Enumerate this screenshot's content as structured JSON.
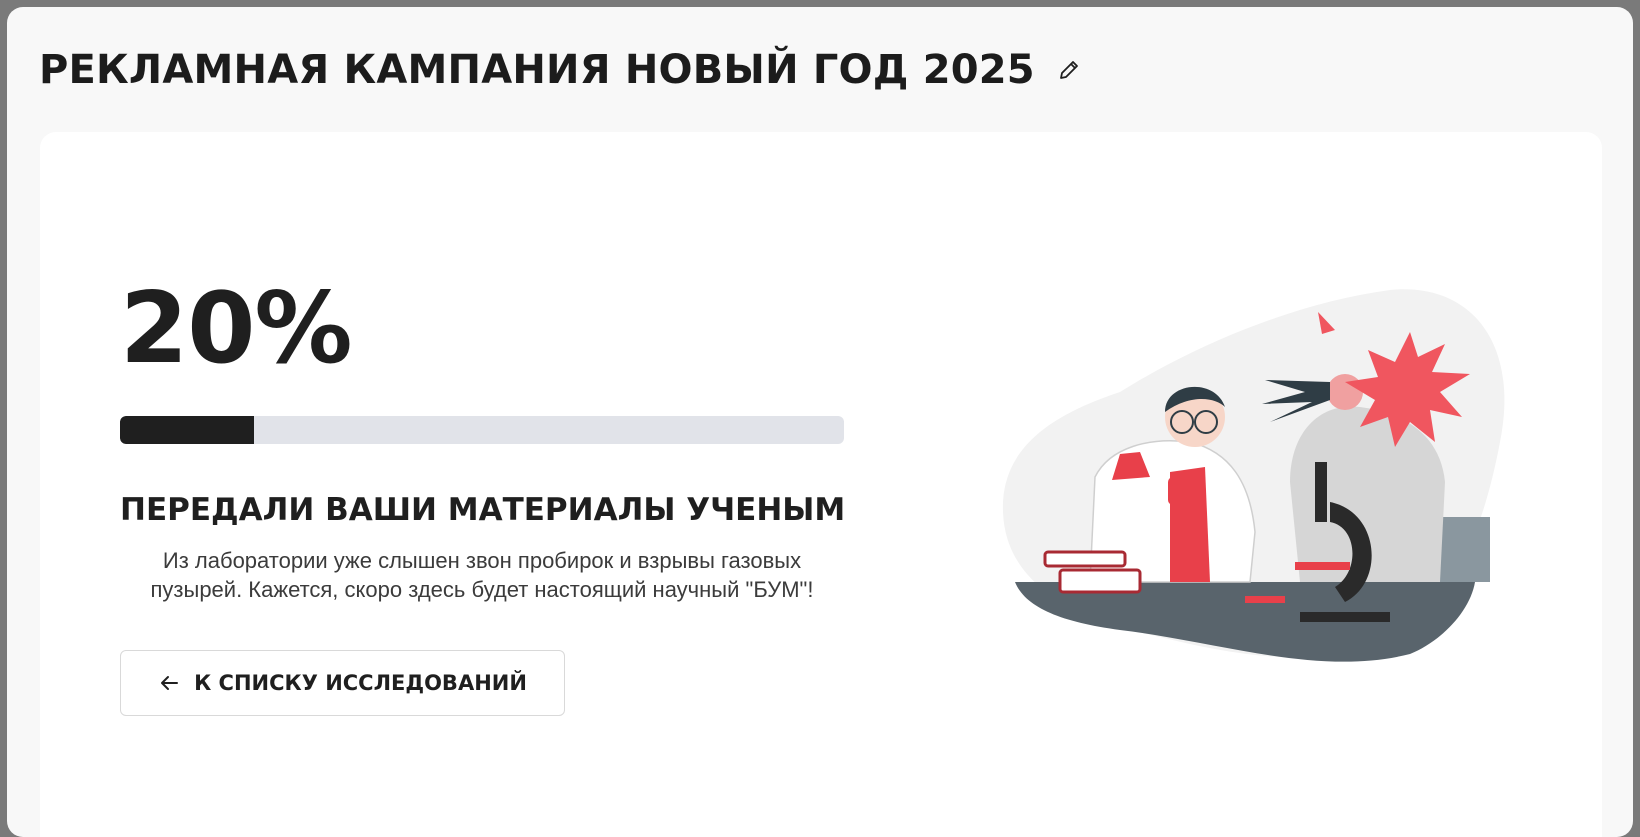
{
  "header": {
    "title": "РЕКЛАМНАЯ КАМПАНИЯ НОВЫЙ ГОД 2025",
    "edit_icon": "pencil-icon"
  },
  "progress": {
    "percent_label": "20%",
    "value": 0.185,
    "fill_color": "#1f1f1f",
    "track_color": "#e1e3e9"
  },
  "status": {
    "title": "ПЕРЕДАЛИ ВАШИ МАТЕРИАЛЫ УЧЕНЫМ",
    "description_line1": "Из лаборатории уже слышен звон пробирок и взрывы газовых",
    "description_line2": "пузырей. Кажется, скоро здесь будет настоящий научный \"БУМ\"!"
  },
  "actions": {
    "back_label": "К СПИСКУ ИССЛЕДОВАНИЙ",
    "back_icon": "arrow-left-icon"
  },
  "illustration": {
    "name": "scientists-lab-illustration",
    "accent_color": "#e8404a"
  }
}
